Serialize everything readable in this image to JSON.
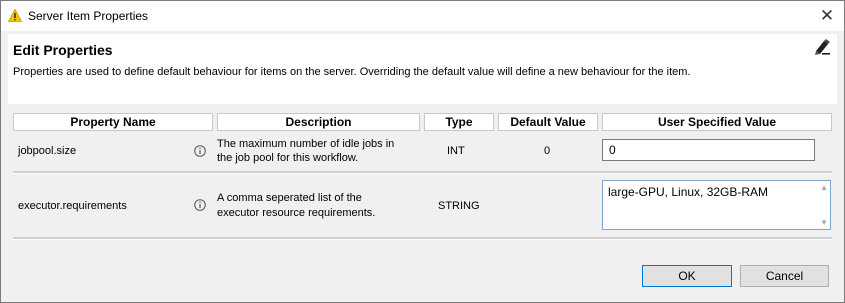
{
  "window": {
    "title": "Server Item Properties",
    "close_glyph": "✕"
  },
  "header": {
    "title": "Edit Properties",
    "description": "Properties are used to define default behaviour for items on the server. Overriding the default value will define a new behaviour for the item."
  },
  "table": {
    "columns": [
      "Property Name",
      "Description",
      "Type",
      "Default Value",
      "User Specified Value"
    ],
    "rows": [
      {
        "name": "jobpool.size",
        "description_line1": "The maximum number of idle jobs in",
        "description_line2": "the job pool for this workflow.",
        "type": "INT",
        "default": "0",
        "user_value": "0"
      },
      {
        "name": "executor.requirements",
        "description_line1": "A comma seperated list of the",
        "description_line2": "executor resource requirements.",
        "type": "STRING",
        "default": "",
        "user_value": "large-GPU, Linux, 32GB-RAM"
      }
    ]
  },
  "buttons": {
    "ok": "OK",
    "cancel": "Cancel"
  },
  "icons": {
    "title": "warning-triangle-icon",
    "info": "info-icon",
    "edit": "edit-pencil-icon"
  },
  "colors": {
    "warning_yellow": "#f5c400",
    "focus_border": "#7fa6d1",
    "ok_border": "#0078d7"
  }
}
